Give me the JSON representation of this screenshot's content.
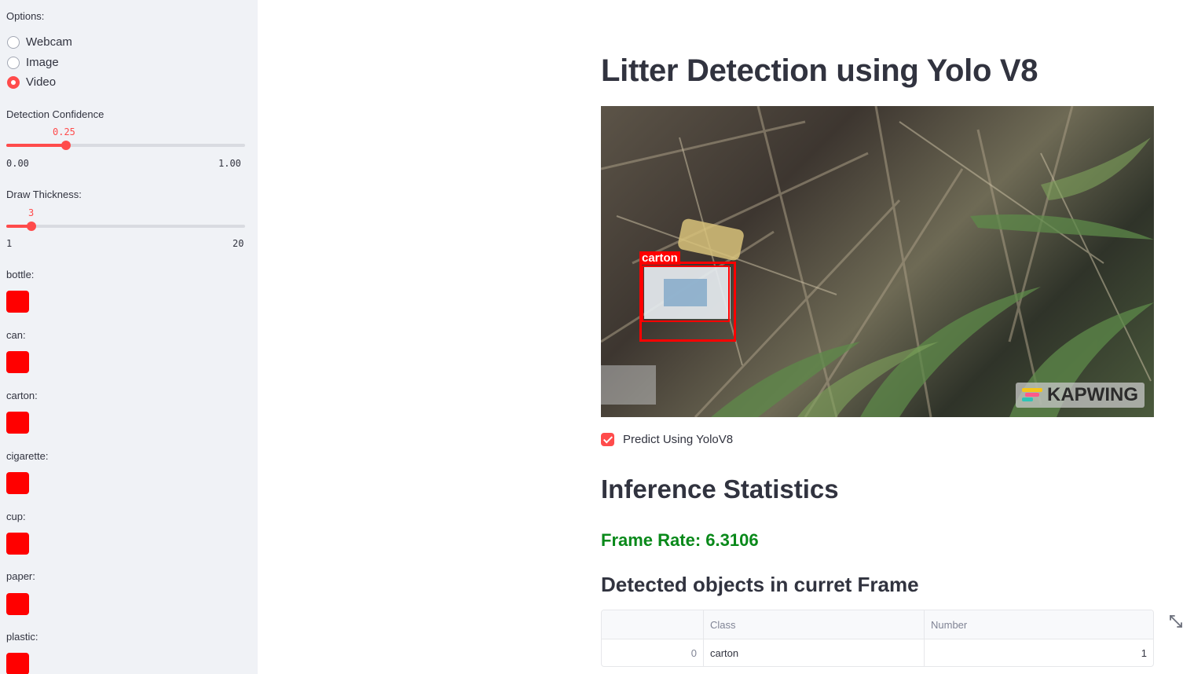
{
  "sidebar": {
    "options_label": "Options:",
    "radio_options": [
      {
        "label": "Webcam",
        "checked": false
      },
      {
        "label": "Image",
        "checked": false
      },
      {
        "label": "Video",
        "checked": true
      }
    ],
    "confidence": {
      "label": "Detection Confidence",
      "value": "0.25",
      "min": "0.00",
      "max": "1.00",
      "fraction": 0.25
    },
    "thickness": {
      "label": "Draw Thickness:",
      "value": "3",
      "min": "1",
      "max": "20",
      "fraction": 0.105
    },
    "class_colors": [
      {
        "label": "bottle:",
        "color": "#ff0000"
      },
      {
        "label": "can:",
        "color": "#ff0000"
      },
      {
        "label": "carton:",
        "color": "#ff0000"
      },
      {
        "label": "cigarette:",
        "color": "#ff0000"
      },
      {
        "label": "cup:",
        "color": "#ff0000"
      },
      {
        "label": "paper:",
        "color": "#ff0000"
      },
      {
        "label": "plastic:",
        "color": "#ff0000"
      }
    ]
  },
  "main": {
    "title": "Litter Detection using Yolo V8",
    "frame": {
      "detection_label": "carton",
      "watermark": "KAPWING"
    },
    "predict_checkbox": {
      "label": "Predict Using YoloV8",
      "checked": true
    },
    "stats_heading": "Inference Statistics",
    "frame_rate": "Frame Rate: 6.3106",
    "detected_heading": "Detected objects in curret Frame",
    "table": {
      "columns": [
        "",
        "Class",
        "Number"
      ],
      "rows": [
        {
          "index": "0",
          "class": "carton",
          "number": "1"
        }
      ]
    }
  },
  "colors": {
    "accent": "#ff4b4b",
    "sidebar_bg": "#f0f2f6",
    "frame_rate_green": "#09891a",
    "detection_red": "#ff0000"
  }
}
